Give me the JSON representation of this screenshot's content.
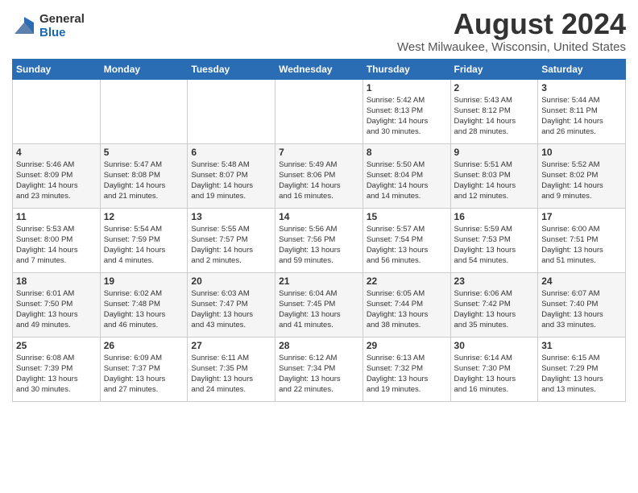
{
  "header": {
    "logo_general": "General",
    "logo_blue": "Blue",
    "month_title": "August 2024",
    "location": "West Milwaukee, Wisconsin, United States"
  },
  "days_of_week": [
    "Sunday",
    "Monday",
    "Tuesday",
    "Wednesday",
    "Thursday",
    "Friday",
    "Saturday"
  ],
  "weeks": [
    [
      {
        "day": "",
        "detail": ""
      },
      {
        "day": "",
        "detail": ""
      },
      {
        "day": "",
        "detail": ""
      },
      {
        "day": "",
        "detail": ""
      },
      {
        "day": "1",
        "detail": "Sunrise: 5:42 AM\nSunset: 8:13 PM\nDaylight: 14 hours\nand 30 minutes."
      },
      {
        "day": "2",
        "detail": "Sunrise: 5:43 AM\nSunset: 8:12 PM\nDaylight: 14 hours\nand 28 minutes."
      },
      {
        "day": "3",
        "detail": "Sunrise: 5:44 AM\nSunset: 8:11 PM\nDaylight: 14 hours\nand 26 minutes."
      }
    ],
    [
      {
        "day": "4",
        "detail": "Sunrise: 5:46 AM\nSunset: 8:09 PM\nDaylight: 14 hours\nand 23 minutes."
      },
      {
        "day": "5",
        "detail": "Sunrise: 5:47 AM\nSunset: 8:08 PM\nDaylight: 14 hours\nand 21 minutes."
      },
      {
        "day": "6",
        "detail": "Sunrise: 5:48 AM\nSunset: 8:07 PM\nDaylight: 14 hours\nand 19 minutes."
      },
      {
        "day": "7",
        "detail": "Sunrise: 5:49 AM\nSunset: 8:06 PM\nDaylight: 14 hours\nand 16 minutes."
      },
      {
        "day": "8",
        "detail": "Sunrise: 5:50 AM\nSunset: 8:04 PM\nDaylight: 14 hours\nand 14 minutes."
      },
      {
        "day": "9",
        "detail": "Sunrise: 5:51 AM\nSunset: 8:03 PM\nDaylight: 14 hours\nand 12 minutes."
      },
      {
        "day": "10",
        "detail": "Sunrise: 5:52 AM\nSunset: 8:02 PM\nDaylight: 14 hours\nand 9 minutes."
      }
    ],
    [
      {
        "day": "11",
        "detail": "Sunrise: 5:53 AM\nSunset: 8:00 PM\nDaylight: 14 hours\nand 7 minutes."
      },
      {
        "day": "12",
        "detail": "Sunrise: 5:54 AM\nSunset: 7:59 PM\nDaylight: 14 hours\nand 4 minutes."
      },
      {
        "day": "13",
        "detail": "Sunrise: 5:55 AM\nSunset: 7:57 PM\nDaylight: 14 hours\nand 2 minutes."
      },
      {
        "day": "14",
        "detail": "Sunrise: 5:56 AM\nSunset: 7:56 PM\nDaylight: 13 hours\nand 59 minutes."
      },
      {
        "day": "15",
        "detail": "Sunrise: 5:57 AM\nSunset: 7:54 PM\nDaylight: 13 hours\nand 56 minutes."
      },
      {
        "day": "16",
        "detail": "Sunrise: 5:59 AM\nSunset: 7:53 PM\nDaylight: 13 hours\nand 54 minutes."
      },
      {
        "day": "17",
        "detail": "Sunrise: 6:00 AM\nSunset: 7:51 PM\nDaylight: 13 hours\nand 51 minutes."
      }
    ],
    [
      {
        "day": "18",
        "detail": "Sunrise: 6:01 AM\nSunset: 7:50 PM\nDaylight: 13 hours\nand 49 minutes."
      },
      {
        "day": "19",
        "detail": "Sunrise: 6:02 AM\nSunset: 7:48 PM\nDaylight: 13 hours\nand 46 minutes."
      },
      {
        "day": "20",
        "detail": "Sunrise: 6:03 AM\nSunset: 7:47 PM\nDaylight: 13 hours\nand 43 minutes."
      },
      {
        "day": "21",
        "detail": "Sunrise: 6:04 AM\nSunset: 7:45 PM\nDaylight: 13 hours\nand 41 minutes."
      },
      {
        "day": "22",
        "detail": "Sunrise: 6:05 AM\nSunset: 7:44 PM\nDaylight: 13 hours\nand 38 minutes."
      },
      {
        "day": "23",
        "detail": "Sunrise: 6:06 AM\nSunset: 7:42 PM\nDaylight: 13 hours\nand 35 minutes."
      },
      {
        "day": "24",
        "detail": "Sunrise: 6:07 AM\nSunset: 7:40 PM\nDaylight: 13 hours\nand 33 minutes."
      }
    ],
    [
      {
        "day": "25",
        "detail": "Sunrise: 6:08 AM\nSunset: 7:39 PM\nDaylight: 13 hours\nand 30 minutes."
      },
      {
        "day": "26",
        "detail": "Sunrise: 6:09 AM\nSunset: 7:37 PM\nDaylight: 13 hours\nand 27 minutes."
      },
      {
        "day": "27",
        "detail": "Sunrise: 6:11 AM\nSunset: 7:35 PM\nDaylight: 13 hours\nand 24 minutes."
      },
      {
        "day": "28",
        "detail": "Sunrise: 6:12 AM\nSunset: 7:34 PM\nDaylight: 13 hours\nand 22 minutes."
      },
      {
        "day": "29",
        "detail": "Sunrise: 6:13 AM\nSunset: 7:32 PM\nDaylight: 13 hours\nand 19 minutes."
      },
      {
        "day": "30",
        "detail": "Sunrise: 6:14 AM\nSunset: 7:30 PM\nDaylight: 13 hours\nand 16 minutes."
      },
      {
        "day": "31",
        "detail": "Sunrise: 6:15 AM\nSunset: 7:29 PM\nDaylight: 13 hours\nand 13 minutes."
      }
    ]
  ]
}
